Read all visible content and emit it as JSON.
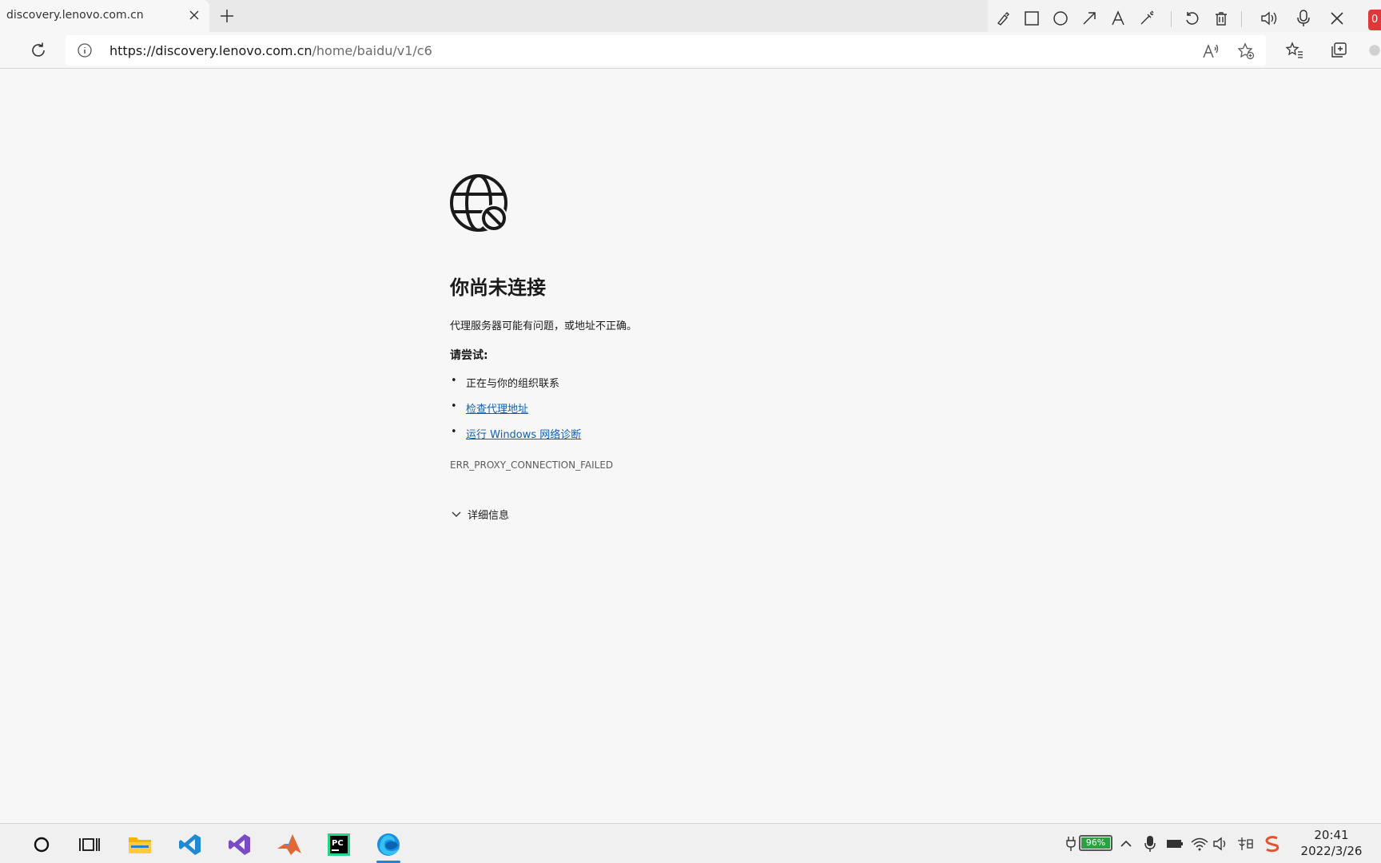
{
  "browser": {
    "tab": {
      "title": "discovery.lenovo.com.cn"
    },
    "address": {
      "url_host": "https://discovery.lenovo.com.cn",
      "url_path": "/home/baidu/v1/c6"
    }
  },
  "annotation_toolbar": {
    "tools": [
      "pen-icon",
      "rectangle-icon",
      "circle-icon",
      "arrow-icon",
      "text-icon",
      "highlighter-icon",
      "undo-icon",
      "delete-icon",
      "speaker-icon",
      "microphone-icon",
      "close-icon"
    ],
    "badge": "0"
  },
  "error_page": {
    "heading": "你尚未连接",
    "description": "代理服务器可能有问题，或地址不正确。",
    "try_label": "请尝试:",
    "suggestions": [
      {
        "text": "正在与你的组织联系",
        "link": false
      },
      {
        "text": "检查代理地址",
        "link": true
      },
      {
        "text": "运行 Windows 网络诊断",
        "link": true
      }
    ],
    "error_code": "ERR_PROXY_CONNECTION_FAILED",
    "details_label": "详细信息"
  },
  "taskbar": {
    "apps": [
      "cortana-icon",
      "task-view-icon",
      "file-explorer-icon",
      "vscode-icon",
      "visual-studio-icon",
      "matlab-icon",
      "pycharm-icon",
      "edge-icon"
    ],
    "battery": "96%",
    "time": "20:41",
    "date": "2022/3/26"
  },
  "colors": {
    "link": "#0f5fb5",
    "accent": "#2a7fd4",
    "battery": "#2ea043",
    "badge": "#e0383a"
  }
}
